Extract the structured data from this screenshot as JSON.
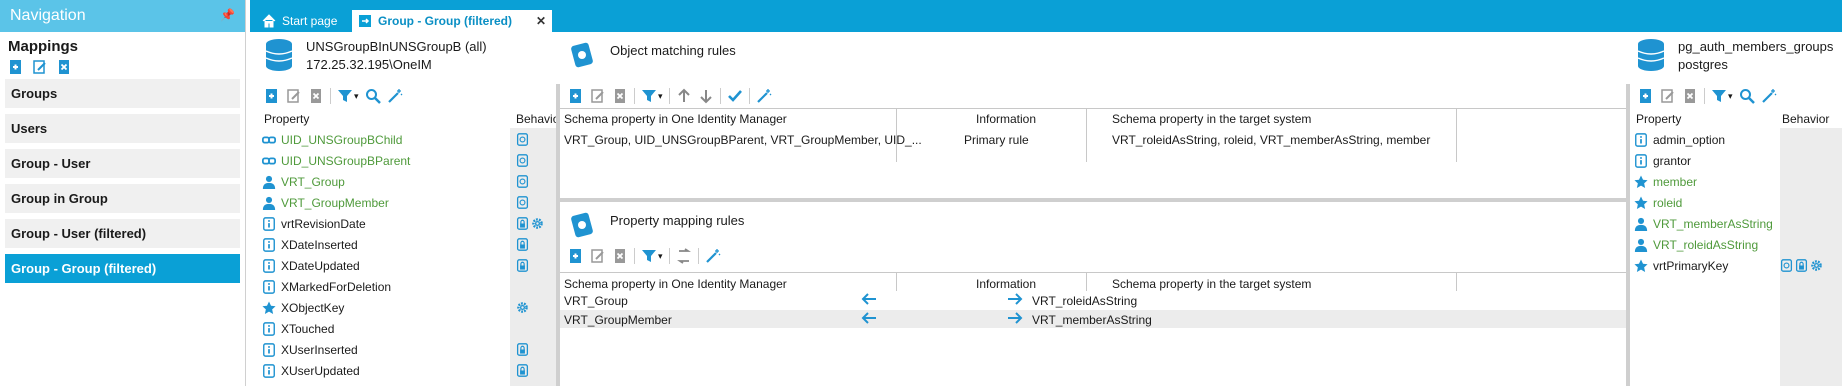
{
  "nav": {
    "header": "Navigation",
    "pin_icon": "pin-icon",
    "title": "Mappings",
    "items": [
      {
        "label": "Groups",
        "active": false
      },
      {
        "label": "Users",
        "active": false
      },
      {
        "label": "Group - User",
        "active": false
      },
      {
        "label": "Group in Group",
        "active": false
      },
      {
        "label": "Group - User (filtered)",
        "active": false
      },
      {
        "label": "Group - Group (filtered)",
        "active": true
      }
    ]
  },
  "tabs": {
    "start": "Start page",
    "current": "Group - Group (filtered)",
    "close": "✕"
  },
  "left": {
    "db_name": "UNSGroupBInUNSGroupB (all)",
    "db_server": "172.25.32.195\\OneIM",
    "col_property": "Property",
    "col_behavior": "Behavior",
    "properties": [
      {
        "name": "UID_UNSGroupBChild",
        "icon": "link-icon",
        "green": true,
        "behavior": [
          "doc-icon"
        ]
      },
      {
        "name": "UID_UNSGroupBParent",
        "icon": "link-icon",
        "green": true,
        "behavior": [
          "doc-icon"
        ]
      },
      {
        "name": "VRT_Group",
        "icon": "person-icon",
        "green": true,
        "behavior": [
          "doc-icon"
        ]
      },
      {
        "name": "VRT_GroupMember",
        "icon": "person-icon",
        "green": true,
        "behavior": [
          "doc-icon"
        ]
      },
      {
        "name": "vrtRevisionDate",
        "icon": "info-icon",
        "green": false,
        "behavior": [
          "lock-icon",
          "gear-icon"
        ]
      },
      {
        "name": "XDateInserted",
        "icon": "info-icon",
        "green": false,
        "behavior": [
          "lock-icon"
        ]
      },
      {
        "name": "XDateUpdated",
        "icon": "info-icon",
        "green": false,
        "behavior": [
          "lock-icon"
        ]
      },
      {
        "name": "XMarkedForDeletion",
        "icon": "info-icon",
        "green": false,
        "behavior": []
      },
      {
        "name": "XObjectKey",
        "icon": "star-icon",
        "green": false,
        "behavior": [
          "gear-icon"
        ]
      },
      {
        "name": "XTouched",
        "icon": "info-icon",
        "green": false,
        "behavior": []
      },
      {
        "name": "XUserInserted",
        "icon": "info-icon",
        "green": false,
        "behavior": [
          "lock-icon"
        ]
      },
      {
        "name": "XUserUpdated",
        "icon": "info-icon",
        "green": false,
        "behavior": [
          "lock-icon"
        ]
      }
    ]
  },
  "middle": {
    "object_title": "Object matching rules",
    "object_cols": [
      "Schema property in One Identity Manager",
      "Information",
      "Schema property in the target system"
    ],
    "object_rows": [
      {
        "left": "VRT_Group, UID_UNSGroupBParent, VRT_GroupMember, UID_...",
        "info": "Primary rule",
        "right": "VRT_roleidAsString, roleid, VRT_memberAsString, member"
      }
    ],
    "property_title": "Property mapping rules",
    "property_cols": [
      "Schema property in One Identity Manager",
      "Information",
      "Schema property in the target system"
    ],
    "property_rows": [
      {
        "left": "VRT_Group",
        "right": "VRT_roleidAsString"
      },
      {
        "left": "VRT_GroupMember",
        "right": "VRT_memberAsString"
      }
    ]
  },
  "right": {
    "db_name": "pg_auth_members_groups",
    "db_server": "postgres",
    "col_property": "Property",
    "col_behavior": "Behavior",
    "properties": [
      {
        "name": "admin_option",
        "icon": "info-icon",
        "green": false,
        "behavior": []
      },
      {
        "name": "grantor",
        "icon": "info-icon",
        "green": false,
        "behavior": []
      },
      {
        "name": "member",
        "icon": "star-icon",
        "green": true,
        "behavior": []
      },
      {
        "name": "roleid",
        "icon": "star-icon",
        "green": true,
        "behavior": []
      },
      {
        "name": "VRT_memberAsString",
        "icon": "person-icon",
        "green": true,
        "behavior": []
      },
      {
        "name": "VRT_roleidAsString",
        "icon": "person-icon",
        "green": true,
        "behavior": []
      },
      {
        "name": "vrtPrimaryKey",
        "icon": "star-icon",
        "green": false,
        "behavior": [
          "doc-icon",
          "lock-icon",
          "gear-icon"
        ]
      }
    ]
  },
  "colors": {
    "accent": "#0aa0d6",
    "nav_header": "#5bc4e8",
    "green_text": "#4f9a3b"
  }
}
